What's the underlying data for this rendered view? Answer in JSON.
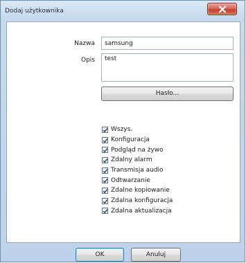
{
  "window": {
    "title": "Dodaj użytkownika"
  },
  "form": {
    "name_label": "Nazwa",
    "name_value": "samsung",
    "desc_label": "Opis",
    "desc_value": "test",
    "password_button": "Hasło..."
  },
  "permissions": [
    {
      "label": "Wszys.",
      "checked": true
    },
    {
      "label": "Konfiguracja",
      "checked": true
    },
    {
      "label": "Podgląd na żywo",
      "checked": true
    },
    {
      "label": "Zdalny alarm",
      "checked": true
    },
    {
      "label": "Transmisja audio",
      "checked": true
    },
    {
      "label": "Odtwarzanie",
      "checked": true
    },
    {
      "label": "Zdalne kopiowanie",
      "checked": true
    },
    {
      "label": "Zdalna konfiguracja",
      "checked": true
    },
    {
      "label": "Zdalna aktualizacja",
      "checked": true
    }
  ],
  "footer": {
    "ok_label": "OK",
    "cancel_label": "Anuluj"
  }
}
